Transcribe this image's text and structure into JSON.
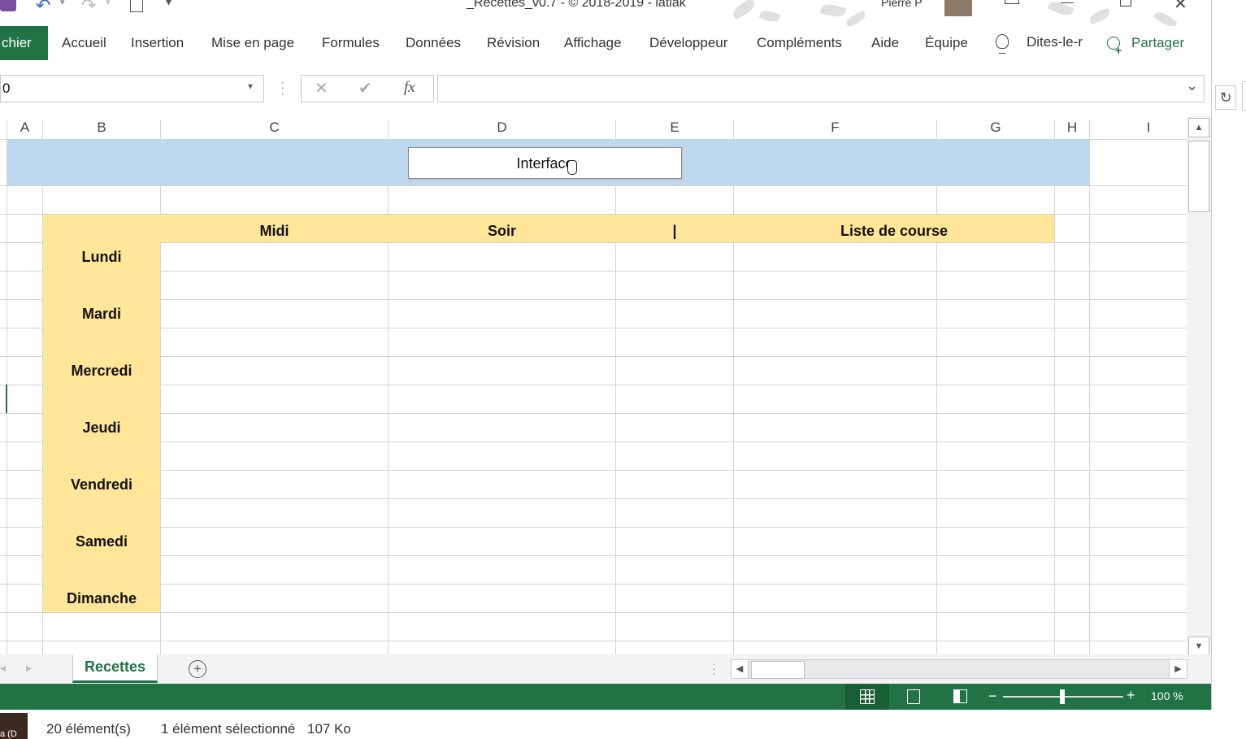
{
  "window": {
    "title": "_Recettes_v0.7  -  © 2018-2019 - latiak",
    "user": "Pierre P"
  },
  "ribbon": {
    "file_tab": "chier",
    "tabs": [
      "Accueil",
      "Insertion",
      "Mise en page",
      "Formules",
      "Données",
      "Révision",
      "Affichage",
      "Développeur",
      "Compléments",
      "Aide",
      "Équipe"
    ],
    "tell_me": "Dites-le-r",
    "share": "Partager"
  },
  "formula_bar": {
    "name_box": "0",
    "fx": "fx",
    "formula": ""
  },
  "columns": [
    "A",
    "B",
    "C",
    "D",
    "E",
    "F",
    "G",
    "H",
    "I"
  ],
  "sheet": {
    "button_label": "Interface",
    "headers": {
      "midi": "Midi",
      "soir": "Soir",
      "sep": "|",
      "liste": "Liste de course"
    },
    "days": [
      "Lundi",
      "Mardi",
      "Mercredi",
      "Jeudi",
      "Vendredi",
      "Samedi",
      "Dimanche"
    ]
  },
  "sheet_tabs": {
    "active": "Recettes"
  },
  "status": {
    "zoom": "100 %"
  },
  "explorer": {
    "items_count": "20 élément(s)",
    "selected": "1 élément sélectionné",
    "size": "107 Ko",
    "side_text": "a (D"
  },
  "colors": {
    "excel_green": "#217346",
    "banner_blue": "#bdd7ee",
    "header_yellow": "#ffe699"
  }
}
